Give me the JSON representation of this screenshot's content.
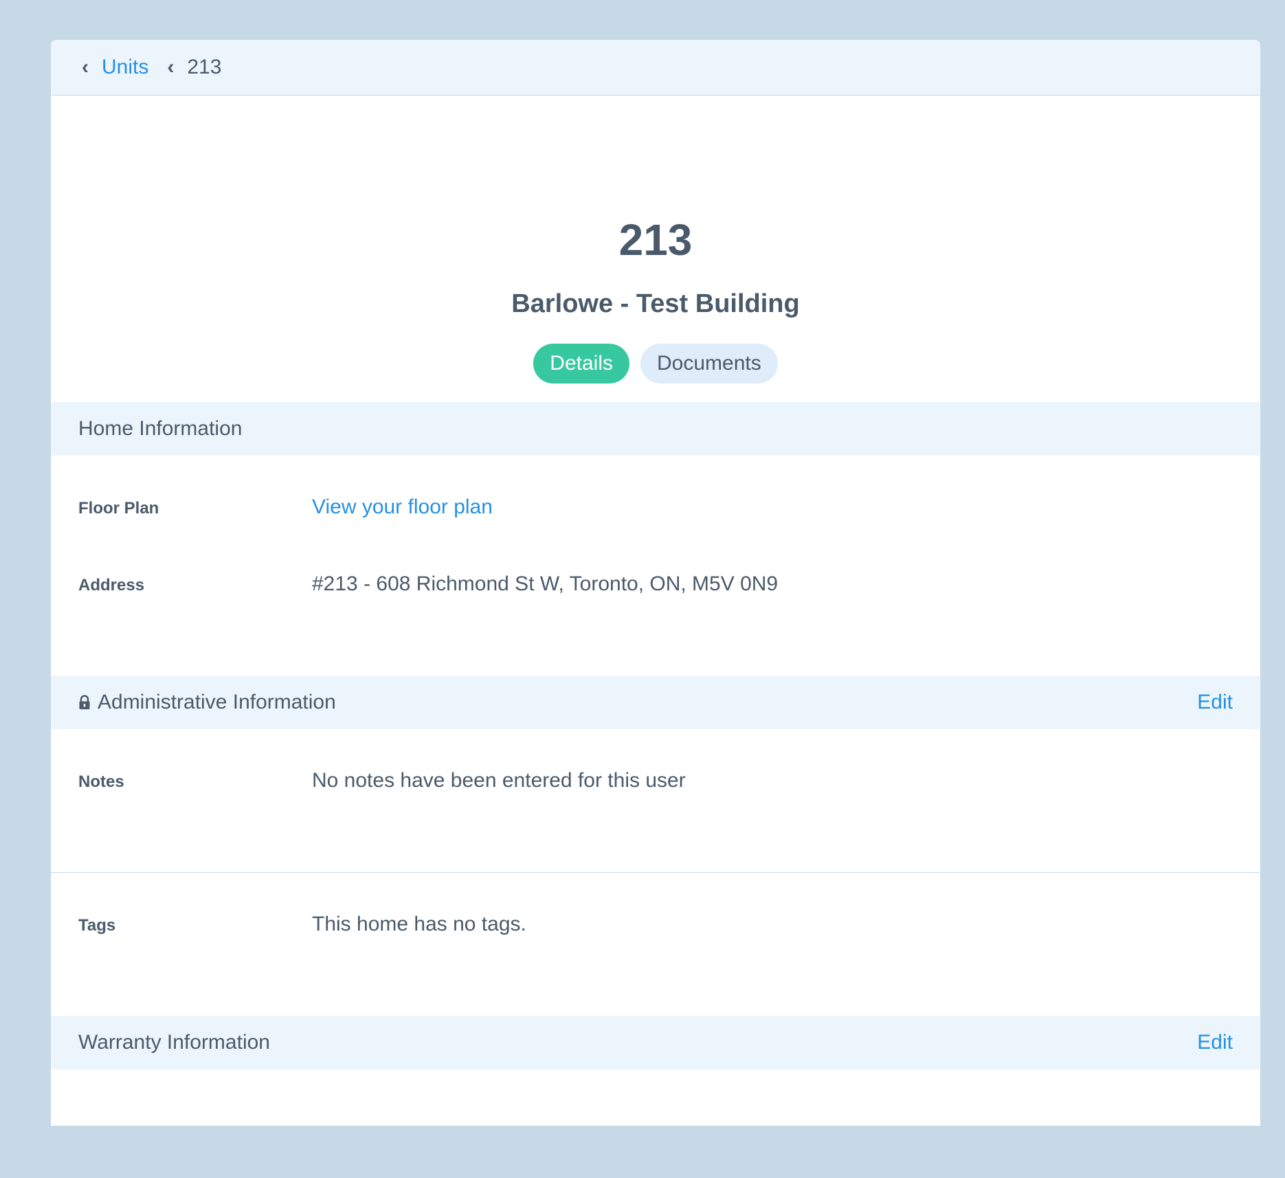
{
  "breadcrumb": {
    "parent_label": "Units",
    "current_label": "213"
  },
  "hero": {
    "title": "213",
    "building": "Barlowe - Test Building",
    "tabs": [
      {
        "label": "Details",
        "active": true
      },
      {
        "label": "Documents",
        "active": false
      }
    ]
  },
  "home_info": {
    "header": "Home Information",
    "floor_plan_label": "Floor Plan",
    "floor_plan_link": "View your floor plan",
    "address_label": "Address",
    "address_value": "#213 - 608 Richmond St W, Toronto, ON, M5V 0N9"
  },
  "admin_info": {
    "header": "Administrative Information",
    "edit_label": "Edit",
    "notes_label": "Notes",
    "notes_value": "No notes have been entered for this user",
    "tags_label": "Tags",
    "tags_value": "This home has no tags."
  },
  "warranty_info": {
    "header": "Warranty Information",
    "edit_label": "Edit"
  },
  "colors": {
    "accent": "#2590e4",
    "active_tab": "#38c8a0",
    "page_bg": "#c6d9e7",
    "section_bg": "#ecf5fc"
  },
  "icons": [
    "chevron-left-icon",
    "lock-icon"
  ]
}
